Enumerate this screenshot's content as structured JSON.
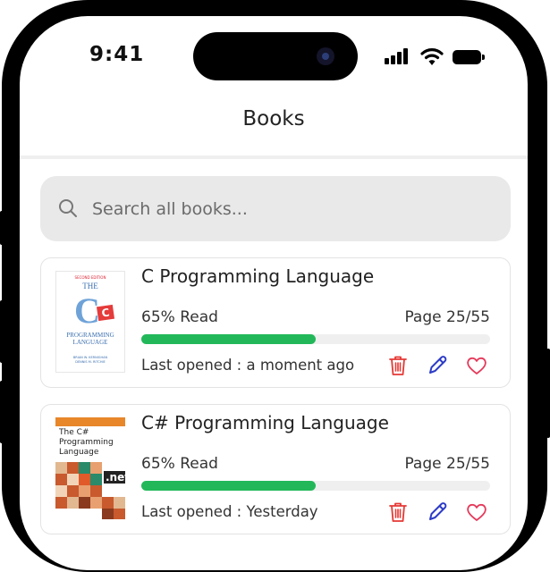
{
  "status_bar": {
    "time": "9:41"
  },
  "header": {
    "title": "Books"
  },
  "search": {
    "placeholder": "Search all books..."
  },
  "books": [
    {
      "title": "C Programming Language",
      "progress_text": "65% Read",
      "progress": 0.5,
      "page": "Page 25/55",
      "last_opened": "Last opened : a moment ago",
      "cover": {
        "edition": "SECOND EDITION",
        "the": "THE",
        "big_letter": "C",
        "badge_letter": "C",
        "lines": [
          "PROGRAMMING",
          "LANGUAGE"
        ],
        "authors": [
          "BRIAN W. KERNIGHAN",
          "DENNIS M. RITCHIE"
        ]
      }
    },
    {
      "title": "C# Programming Language",
      "progress_text": "65% Read",
      "progress": 0.5,
      "page": "Page 25/55",
      "last_opened": "Last opened : Yesterday",
      "cover": {
        "lines": [
          "The C#",
          "Programming",
          "Language"
        ],
        "badge": ".net"
      }
    }
  ],
  "colors": {
    "progress": "#22b85a",
    "delete": "#e53935",
    "edit": "#2d3cc7",
    "favorite": "#e5395a"
  },
  "icons": {
    "search": "search-icon",
    "delete": "trash-icon",
    "edit": "pencil-icon",
    "favorite": "heart-icon"
  }
}
